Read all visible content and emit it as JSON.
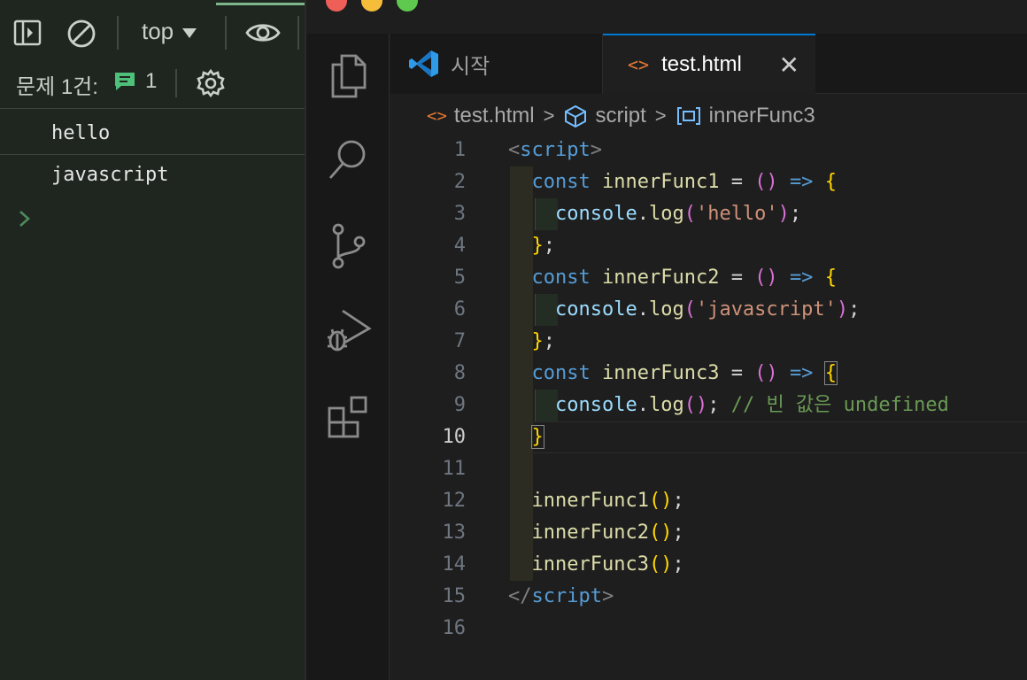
{
  "devtools": {
    "context_label": "top",
    "issues_label": "문제 1건:",
    "issues_count": "1",
    "logs": [
      "hello",
      "javascript"
    ]
  },
  "tabs": [
    {
      "label": "시작",
      "icon": "vscode-logo-icon",
      "active": false
    },
    {
      "label": "test.html",
      "icon": "html-file-icon",
      "active": true
    }
  ],
  "breadcrumb": {
    "file": "test.html",
    "symbol": "script",
    "member": "innerFunc3"
  },
  "editor": {
    "current_line": 10,
    "line_numbers": [
      "1",
      "2",
      "3",
      "4",
      "5",
      "6",
      "7",
      "8",
      "9",
      "10",
      "11",
      "12",
      "13",
      "14",
      "15",
      "16"
    ]
  },
  "code": {
    "script_open": "script",
    "const": "const",
    "inner1": "innerFunc1",
    "inner2": "innerFunc2",
    "inner3": "innerFunc3",
    "eq": "=",
    "arrow": "=>",
    "console": "console",
    "log": "log",
    "str_hello": "'hello'",
    "str_js": "'javascript'",
    "comment": "// 빈 값은 undefined",
    "script_close": "script"
  },
  "colors": {
    "accent": "#0078d4",
    "devtools_bg": "#1f2620",
    "editor_bg": "#1e1e1e"
  }
}
